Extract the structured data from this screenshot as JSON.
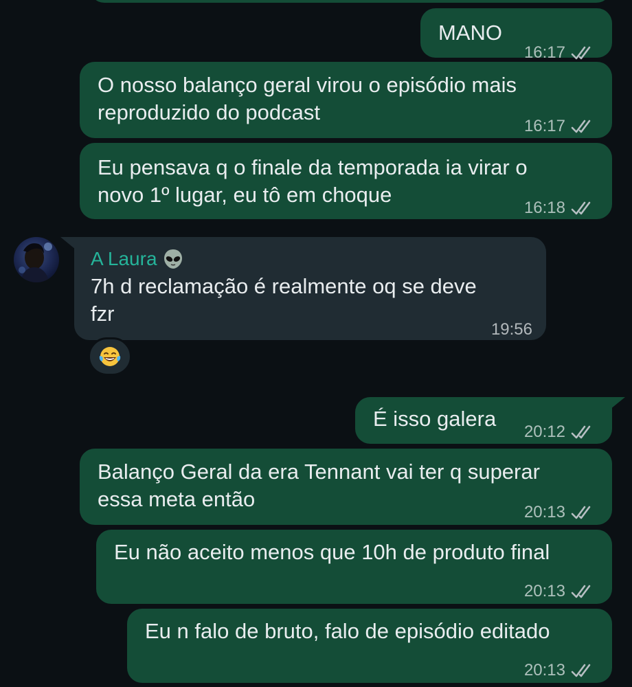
{
  "messages": [
    {
      "text": "MANO",
      "time": "16:17"
    },
    {
      "text": "O nosso balanço geral virou o episódio mais\nreproduzido do podcast",
      "time": "16:17"
    },
    {
      "text": "Eu pensava q o finale da temporada ia virar o\nnovo 1º lugar, eu tô em choque",
      "time": "16:18"
    },
    {
      "sender": "A Laura",
      "text": "7h d reclamação é realmente oq se deve\nfzr",
      "time": "19:56",
      "reaction": "face-with-tears-of-joy"
    },
    {
      "text": "É isso galera",
      "time": "20:12"
    },
    {
      "text": "Balanço Geral da era Tennant vai ter q superar\nessa meta então",
      "time": "20:13"
    },
    {
      "text": "Eu não aceito menos que 10h de produto final",
      "time": "20:13"
    },
    {
      "text": "Eu n falo de bruto, falo de episódio editado",
      "time": "20:13"
    }
  ],
  "colors": {
    "background": "#0b1014",
    "outgoing_bubble": "#144d37",
    "incoming_bubble": "#202c33",
    "sender_name": "#25b49a",
    "meta_text": "#b7bfc3"
  },
  "icons": {
    "read_receipt": "double-check-icon",
    "sender_emoji": "alien-face-icon",
    "reaction": "face-with-tears-of-joy-icon"
  }
}
